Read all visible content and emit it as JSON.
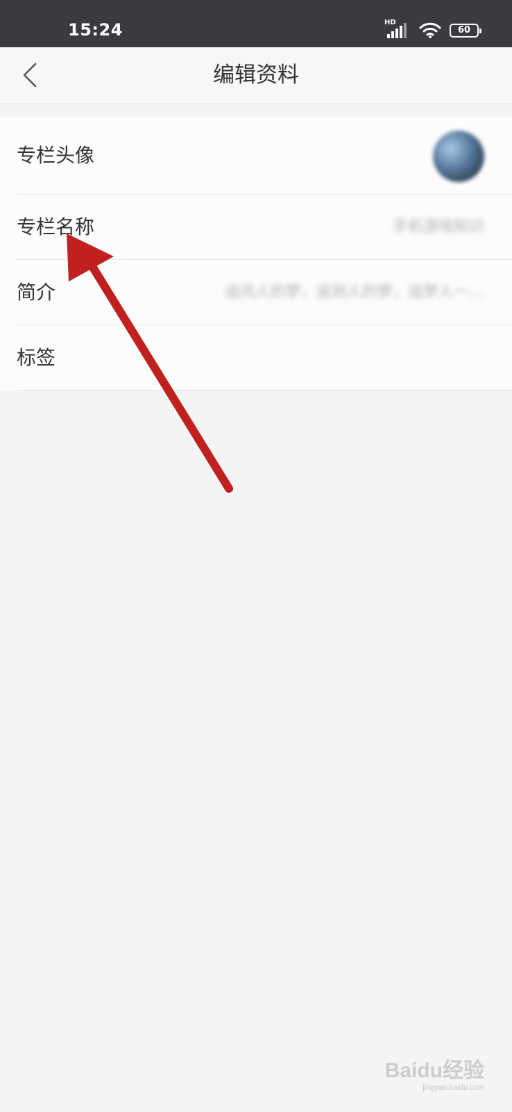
{
  "status_bar": {
    "time": "15:24",
    "network": "HD",
    "battery": "60"
  },
  "header": {
    "title": "编辑资料",
    "back_icon": "chevron-left-icon"
  },
  "settings": {
    "items": [
      {
        "label": "专栏头像",
        "value": ""
      },
      {
        "label": "专栏名称",
        "value": "手机游戏知识"
      },
      {
        "label": "简介",
        "value": "追风人的梦，追到人的梦，追梦人一…"
      },
      {
        "label": "标签",
        "value": ""
      }
    ]
  },
  "watermark": {
    "brand": "Baidu经验",
    "url": "jingyan.baidu.com"
  },
  "colors": {
    "status_bar_bg": "#3a3b3f",
    "arrow": "#c0201e"
  }
}
